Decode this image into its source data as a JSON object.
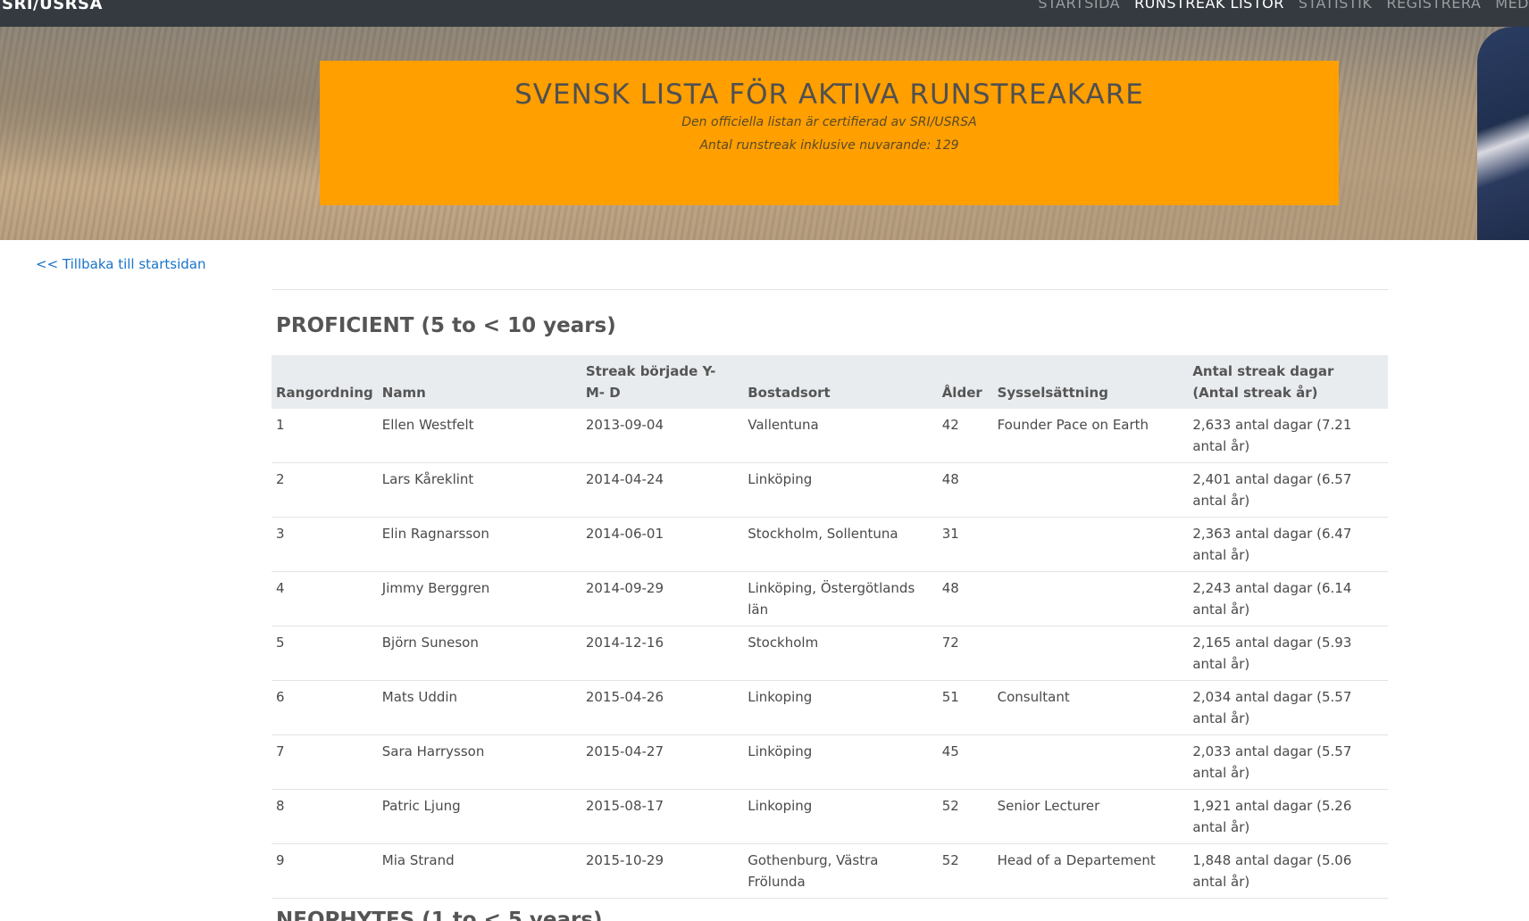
{
  "navbar": {
    "brand": "SRI/USRSA",
    "links": [
      {
        "label": "STARTSIDA",
        "active": false
      },
      {
        "label": "RUNSTREAK LISTOR",
        "active": true
      },
      {
        "label": "STATISTIK",
        "active": false
      },
      {
        "label": "REGISTRERA",
        "active": false
      },
      {
        "label": "MED",
        "active": false
      }
    ]
  },
  "banner": {
    "title": "SVENSK LISTA FÖR AKTIVA RUNSTREAKARE",
    "subtitle1": "Den officiella listan är certifierad av SRI/USRSA",
    "subtitle2": "Antal runstreak inklusive nuvarande: 129",
    "color": "#ff9f00"
  },
  "back_link": "<< Tillbaka till startsidan",
  "section": {
    "title": "PROFICIENT (5 to < 10 years)",
    "columns": {
      "rank": "Rangordning",
      "name": "Namn",
      "start": "Streak började Y- M- D",
      "city": "Bostadsort",
      "age": "Ålder",
      "job": "Sysselsättning",
      "days": "Antal streak dagar (Antal streak år)"
    },
    "rows": [
      {
        "rank": "1",
        "name": "Ellen Westfelt",
        "start": "2013-09-04",
        "city": "Vallentuna",
        "age": "42",
        "job": "Founder Pace on Earth",
        "days": "2,633 antal dagar (7.21 antal år)"
      },
      {
        "rank": "2",
        "name": "Lars Kåreklint",
        "start": "2014-04-24",
        "city": "Linköping",
        "age": "48",
        "job": "",
        "days": "2,401 antal dagar (6.57 antal år)"
      },
      {
        "rank": "3",
        "name": "Elin Ragnarsson",
        "start": "2014-06-01",
        "city": "Stockholm, Sollentuna",
        "age": "31",
        "job": "",
        "days": "2,363 antal dagar (6.47 antal år)"
      },
      {
        "rank": "4",
        "name": "Jimmy Berggren",
        "start": "2014-09-29",
        "city": "Linköping, Östergötlands län",
        "age": "48",
        "job": "",
        "days": "2,243 antal dagar (6.14 antal år)"
      },
      {
        "rank": "5",
        "name": "Björn Suneson",
        "start": "2014-12-16",
        "city": "Stockholm",
        "age": "72",
        "job": "",
        "days": "2,165 antal dagar (5.93 antal år)"
      },
      {
        "rank": "6",
        "name": "Mats Uddin",
        "start": "2015-04-26",
        "city": "Linkoping",
        "age": "51",
        "job": "Consultant",
        "days": "2,034 antal dagar (5.57 antal år)"
      },
      {
        "rank": "7",
        "name": "Sara Harrysson",
        "start": "2015-04-27",
        "city": "Linköping",
        "age": "45",
        "job": "",
        "days": "2,033 antal dagar (5.57 antal år)"
      },
      {
        "rank": "8",
        "name": "Patric Ljung",
        "start": "2015-08-17",
        "city": "Linkoping",
        "age": "52",
        "job": "Senior Lecturer",
        "days": "1,921 antal dagar (5.26 antal år)"
      },
      {
        "rank": "9",
        "name": "Mia Strand",
        "start": "2015-10-29",
        "city": "Gothenburg, Västra Frölunda",
        "age": "52",
        "job": "Head of a Departement",
        "days": "1,848 antal dagar (5.06 antal år)"
      }
    ]
  },
  "next_section_title": "NEOPHYTES (1 to < 5 years)"
}
